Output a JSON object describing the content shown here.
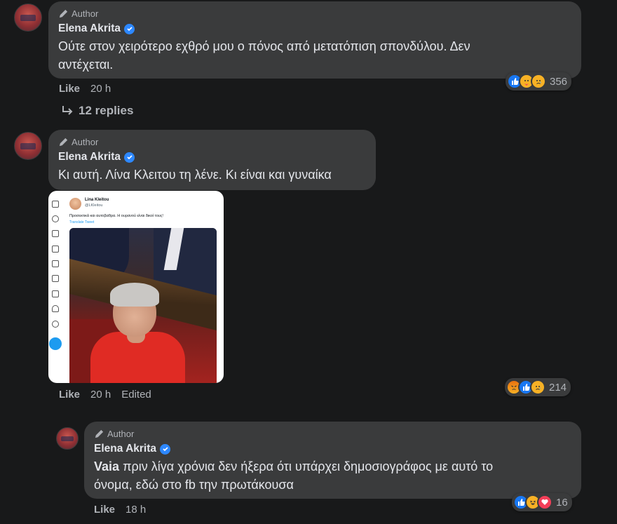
{
  "comments": [
    {
      "author_label": "Author",
      "name": "Elena Akrita",
      "text_lines": [
        "Ούτε στον χειρότερο εχθρό μου ο πόνος από μετατόπιση σπονδύλου. Δεν",
        "αντέχεται."
      ],
      "like_label": "Like",
      "time": "20 h",
      "reactions": [
        "like",
        "care",
        "sad"
      ],
      "reaction_count": "356",
      "replies_label": "12 replies"
    },
    {
      "author_label": "Author",
      "name": "Elena Akrita",
      "text": "Κι αυτή. Λίνα Κλειτου τη λένε. Κι είναι και γυναίκα",
      "like_label": "Like",
      "time": "20 h",
      "edited_label": "Edited",
      "reactions": [
        "angry",
        "like",
        "sad"
      ],
      "reaction_count": "214",
      "embedded_tweet": {
        "name": "Lina Kleitou",
        "handle": "@LKleitou",
        "text": "Προσεκτικά και αυτοβαθρα. Η ουρανού είναι δικοί τους!",
        "translate_label": "Translate Tweet"
      }
    },
    {
      "author_label": "Author",
      "name": "Elena Akrita",
      "mention": "Vaia",
      "text_line1": "πριν λίγα χρόνια δεν ήξερα ότι υπάρχει δημοσιογράφος με αυτό το",
      "text_line2": "όνομα, εδώ στο fb την πρωτάκουσα",
      "like_label": "Like",
      "time": "18 h",
      "reactions": [
        "like",
        "haha",
        "love"
      ],
      "reaction_count": "16"
    }
  ],
  "colors": {
    "background": "#18191a",
    "bubble": "#3a3b3c",
    "verified": "#2d88ff",
    "text": "#e4e6eb",
    "secondary_text": "#b0b3b8"
  },
  "icons": {
    "author_badge": "pencil-icon",
    "verified": "verified-badge-icon",
    "replies": "reply-arrow-icon"
  }
}
